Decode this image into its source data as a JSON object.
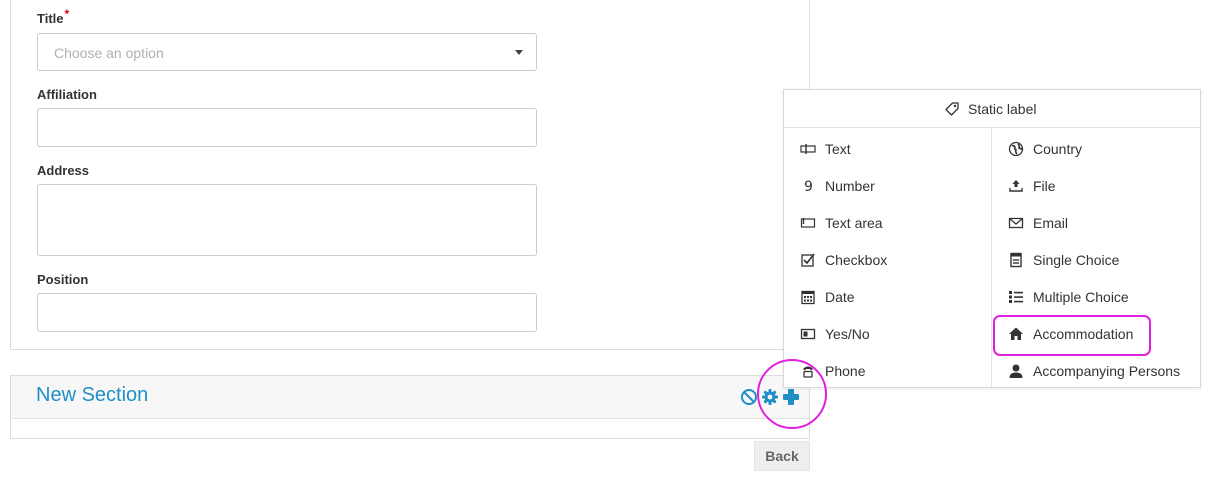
{
  "form": {
    "title_label": "Title",
    "required_mark": "*",
    "title_placeholder": "Choose an option",
    "affiliation_label": "Affiliation",
    "address_label": "Address",
    "position_label": "Position"
  },
  "section": {
    "title": "New Section",
    "back_label": "Back"
  },
  "colors": {
    "accent": "#1f8fc5",
    "highlight": "#e020e0"
  },
  "popup": {
    "header_label": "Static label",
    "header_icon": "tag-icon",
    "left_items": [
      {
        "label": "Text",
        "icon": "text-field-icon"
      },
      {
        "label": "Number",
        "icon": "number-icon"
      },
      {
        "label": "Text area",
        "icon": "textarea-icon"
      },
      {
        "label": "Checkbox",
        "icon": "checkbox-icon"
      },
      {
        "label": "Date",
        "icon": "calendar-icon"
      },
      {
        "label": "Yes/No",
        "icon": "toggle-icon"
      },
      {
        "label": "Phone",
        "icon": "phone-icon"
      }
    ],
    "right_items": [
      {
        "label": "Country",
        "icon": "globe-icon"
      },
      {
        "label": "File",
        "icon": "upload-icon"
      },
      {
        "label": "Email",
        "icon": "envelope-icon"
      },
      {
        "label": "Single Choice",
        "icon": "single-choice-icon"
      },
      {
        "label": "Multiple Choice",
        "icon": "list-icon"
      },
      {
        "label": "Accommodation",
        "icon": "home-icon"
      },
      {
        "label": "Accompanying Persons",
        "icon": "user-icon"
      }
    ]
  }
}
